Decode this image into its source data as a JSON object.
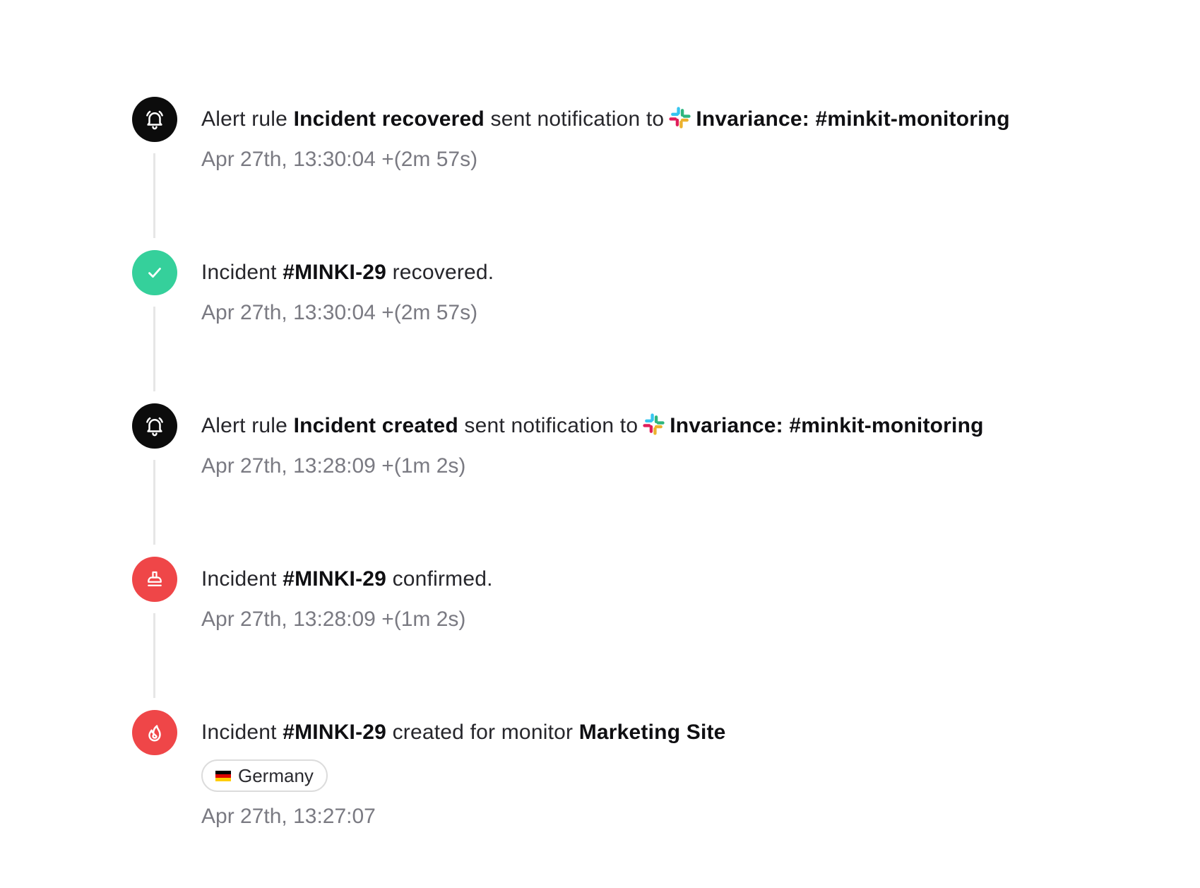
{
  "events": [
    {
      "icon": "bell-icon",
      "icon_color": "#0c0c0c",
      "prefix": "Alert rule ",
      "bold": "Incident recovered",
      "middle": " sent notification to",
      "channel_icon": "slack-icon",
      "channel": "Invariance: #minkit-monitoring",
      "time": "Apr 27th, 13:30:04 +(2m 57s)"
    },
    {
      "icon": "check-icon",
      "icon_color": "#35d09b",
      "prefix": "Incident ",
      "bold": "#MINKI-29",
      "suffix": " recovered.",
      "time": "Apr 27th, 13:30:04 +(2m 57s)"
    },
    {
      "icon": "bell-icon",
      "icon_color": "#0c0c0c",
      "prefix": "Alert rule ",
      "bold": "Incident created",
      "middle": " sent notification to",
      "channel_icon": "slack-icon",
      "channel": "Invariance: #minkit-monitoring",
      "time": "Apr 27th, 13:28:09 +(1m 2s)"
    },
    {
      "icon": "stamp-icon",
      "icon_color": "#ef4648",
      "prefix": "Incident ",
      "bold": "#MINKI-29",
      "suffix": " confirmed.",
      "time": "Apr 27th, 13:28:09 +(1m 2s)"
    },
    {
      "icon": "flame-icon",
      "icon_color": "#ef4648",
      "prefix": "Incident ",
      "bold": "#MINKI-29",
      "middle": " created for monitor ",
      "bold2": "Marketing Site",
      "region_flag": "germany-flag-icon",
      "region": "Germany",
      "time": "Apr 27th, 13:27:07"
    }
  ]
}
